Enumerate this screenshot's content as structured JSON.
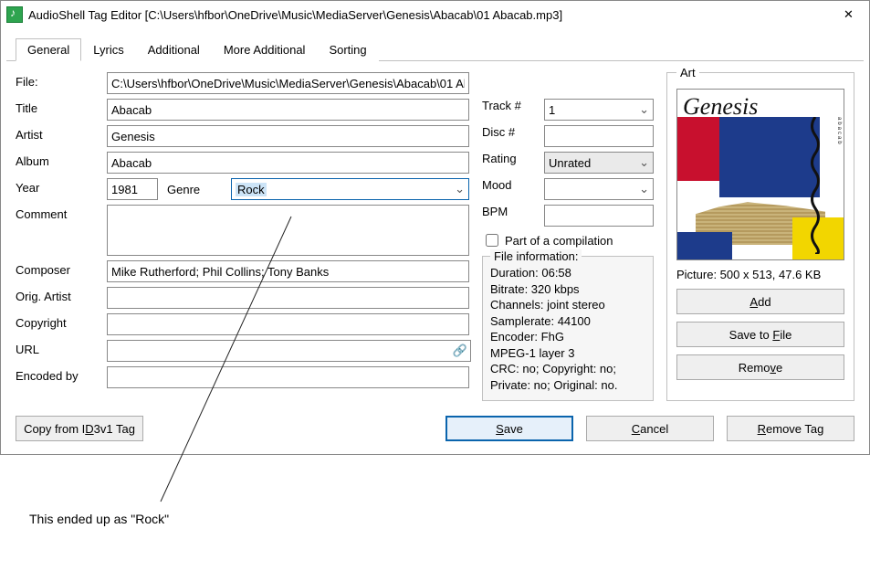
{
  "window": {
    "title": "AudioShell Tag Editor [C:\\Users\\hfbor\\OneDrive\\Music\\MediaServer\\Genesis\\Abacab\\01 Abacab.mp3]",
    "close_glyph": "✕"
  },
  "tabs": {
    "general": "General",
    "lyrics": "Lyrics",
    "additional": "Additional",
    "more_additional": "More Additional",
    "sorting": "Sorting"
  },
  "labels": {
    "file": "File:",
    "title": "Title",
    "artist": "Artist",
    "album": "Album",
    "year": "Year",
    "genre": "Genre",
    "comment": "Comment",
    "composer": "Composer",
    "orig_artist": "Orig. Artist",
    "copyright": "Copyright",
    "url": "URL",
    "encoded_by": "Encoded by",
    "track_no": "Track #",
    "disc_no": "Disc #",
    "rating": "Rating",
    "mood": "Mood",
    "bpm": "BPM",
    "compilation": "Part of a compilation",
    "art": "Art",
    "picture_info": "Picture: 500 x 513, 47.6 KB"
  },
  "values": {
    "file": "C:\\Users\\hfbor\\OneDrive\\Music\\MediaServer\\Genesis\\Abacab\\01 Abacab.mp3",
    "title": "Abacab",
    "artist": "Genesis",
    "album": "Abacab",
    "year": "1981",
    "genre": "Rock",
    "comment": "",
    "composer": "Mike Rutherford; Phil Collins; Tony Banks",
    "orig_artist": "",
    "copyright": "",
    "url": "",
    "encoded_by": "",
    "track_no": "1",
    "disc_no": "",
    "rating": "Unrated",
    "mood": "",
    "bpm": "",
    "compilation_checked": false
  },
  "fileinfo": {
    "header": "File information:",
    "duration": "Duration: 06:58",
    "bitrate": "Bitrate: 320 kbps",
    "channels": "Channels: joint stereo",
    "samplerate": "Samplerate: 44100",
    "encoder": "Encoder: FhG",
    "layer": "MPEG-1 layer 3",
    "crc_copyright": "CRC: no; Copyright: no;",
    "private_original": "Private: no; Original: no."
  },
  "buttons": {
    "add": "Add",
    "save_to_file": "Save to File",
    "remove_art": "Remove",
    "copy_from_id3v1": "Copy from ID3v1 Tag",
    "save": "Save",
    "cancel": "Cancel",
    "remove_tag": "Remove Tag"
  },
  "annotation": "This ended up as \"Rock\"",
  "glyphs": {
    "caret": "⌄",
    "globe": "🔗"
  },
  "art_side_text": "abacab"
}
